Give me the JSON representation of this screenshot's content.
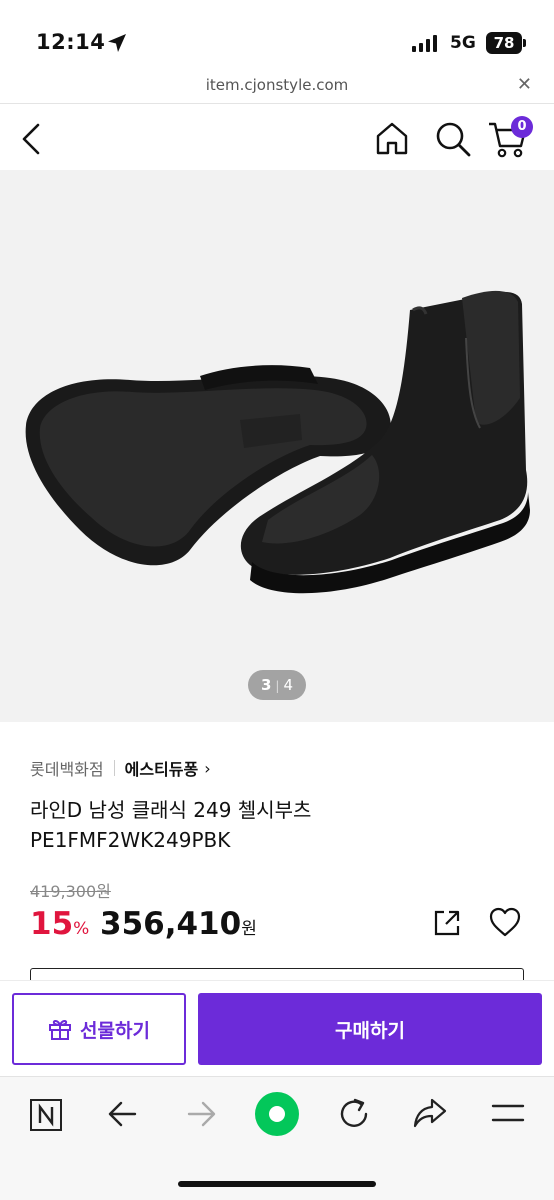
{
  "status_bar": {
    "time": "12:14",
    "network": "5G",
    "battery": "78"
  },
  "browser": {
    "url": "item.cjonstyle.com",
    "close_icon": "close-icon"
  },
  "header": {
    "cart_count": "0",
    "icons": [
      "back-arrow-icon",
      "home-icon",
      "search-icon",
      "cart-icon"
    ]
  },
  "gallery": {
    "current": "3",
    "total": "4"
  },
  "product": {
    "department_store": "롯데백화점",
    "brand": "에스티듀퐁",
    "brand_chevron": "›",
    "name": "라인D 남성 클래식 249 첼시부츠",
    "model_code": "PE1FMF2WK249PBK",
    "original_price": "419,300원",
    "discount_value": "15",
    "discount_unit": "%",
    "sale_price": "356,410",
    "currency": "원"
  },
  "actions": {
    "gift_label": "선물하기",
    "buy_label": "구매하기"
  },
  "browser_toolbar": {
    "icons": [
      "naver-n-icon",
      "back-icon",
      "forward-icon",
      "green-dot-icon",
      "refresh-icon",
      "share-icon",
      "menu-icon"
    ]
  },
  "colors": {
    "accent": "#6c2bd9",
    "discount": "#e0153e",
    "naver_green": "#03c75a"
  }
}
